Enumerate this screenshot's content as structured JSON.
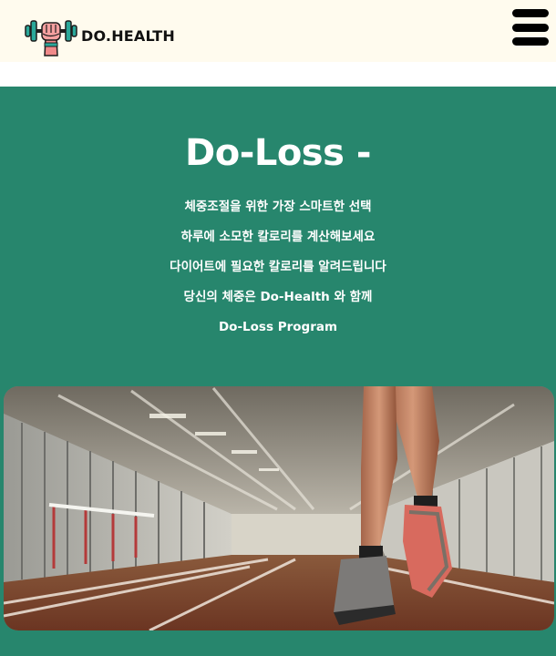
{
  "header": {
    "brand": "DO.HEALTH",
    "logo_icon": "dumbbell-fist-icon",
    "menu_icon": "hamburger-menu-icon"
  },
  "hero": {
    "title": "Do-Loss -",
    "lines": [
      "체중조절을 위한 가장 스마트한 선택",
      "하루에 소모한 칼로리를 계산해보세요",
      "다이어트에 필요한 칼로리를 알려드립니다",
      "당신의 체중은 Do-Health 와 함께",
      "Do-Loss Program"
    ],
    "image": "runner-on-indoor-track-photo"
  },
  "colors": {
    "header_bg": "#fffbee",
    "hero_bg": "#27866d",
    "text_on_hero": "#ffffff",
    "logo_teal": "#2aa89a",
    "logo_pink": "#f08a8a"
  }
}
